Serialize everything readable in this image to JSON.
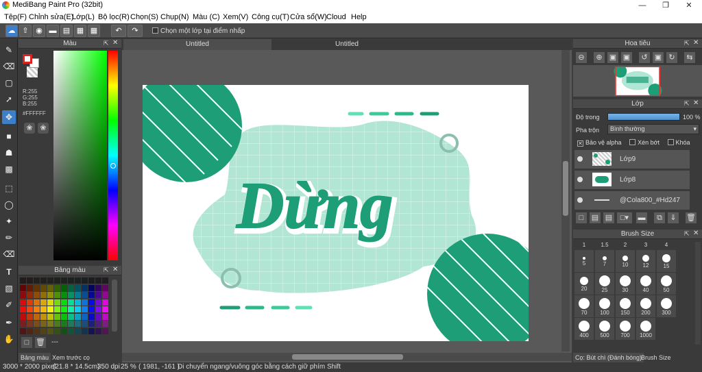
{
  "window": {
    "title": "MediBang Paint Pro (32bit)"
  },
  "menu": [
    "Tệp(F)",
    "Chỉnh sửa(E)",
    "Lớp(L)",
    "Bộ lọc(R)",
    "Chọn(S)",
    "Chụp(N)",
    "Màu (C)",
    "Xem(V)",
    "Công cụ(T)",
    "Cửa sổ(W)",
    "Cloud",
    "Help"
  ],
  "toolbar": {
    "snap_label": "Chọn một lớp tại điểm nhấp"
  },
  "color_panel": {
    "title": "Màu",
    "r": "R:255",
    "g": "G:255",
    "b": "B:255",
    "hex": "#FFFFFF"
  },
  "palette_panel": {
    "title": "Bảng màu",
    "dash": "---"
  },
  "bottom_tabs": [
    "Bảng màu",
    "Xem trước cọ"
  ],
  "document_tabs": [
    "Untitled",
    "Untitled"
  ],
  "canvas": {
    "lettering": "Dừng"
  },
  "navigator": {
    "title": "Hoa tiêu"
  },
  "layers": {
    "title": "Lớp",
    "opacity_label": "Độ trong",
    "opacity_value": "100 %",
    "opacity": 1.0,
    "blend_label": "Pha trộn",
    "blend_value": "Bình thường",
    "alpha_protect": "Bảo vệ alpha",
    "clipping": "Xén bớt",
    "lock": "Khóa",
    "items": [
      {
        "name": "Lớp9"
      },
      {
        "name": "Lớp8"
      },
      {
        "name": "@Cola800_#Hd247"
      }
    ]
  },
  "brush_size": {
    "title": "Brush Size",
    "sizes": [
      "1",
      "1.5",
      "2",
      "3",
      "4",
      "5",
      "7",
      "10",
      "12",
      "15",
      "20",
      "25",
      "30",
      "40",
      "50",
      "70",
      "100",
      "150",
      "200",
      "300",
      "400",
      "500",
      "700",
      "1000"
    ]
  },
  "right_bottom_tabs": [
    "Cọ: Bút chì (Đánh bóng)",
    "Brush Size"
  ],
  "status": {
    "dims": "3000 * 2000 pixel",
    "size": "(21.8 * 14.5cm)",
    "dpi": "350 dpi",
    "zoom": "25 %",
    "coords": "( 1981, -161 )",
    "hint": "Di chuyển ngang/vuông góc bằng cách giữ phím Shift"
  },
  "colors": {
    "accent": "#3d7fc8",
    "teal": "#1e9e76",
    "mint": "#b2e6d4"
  }
}
